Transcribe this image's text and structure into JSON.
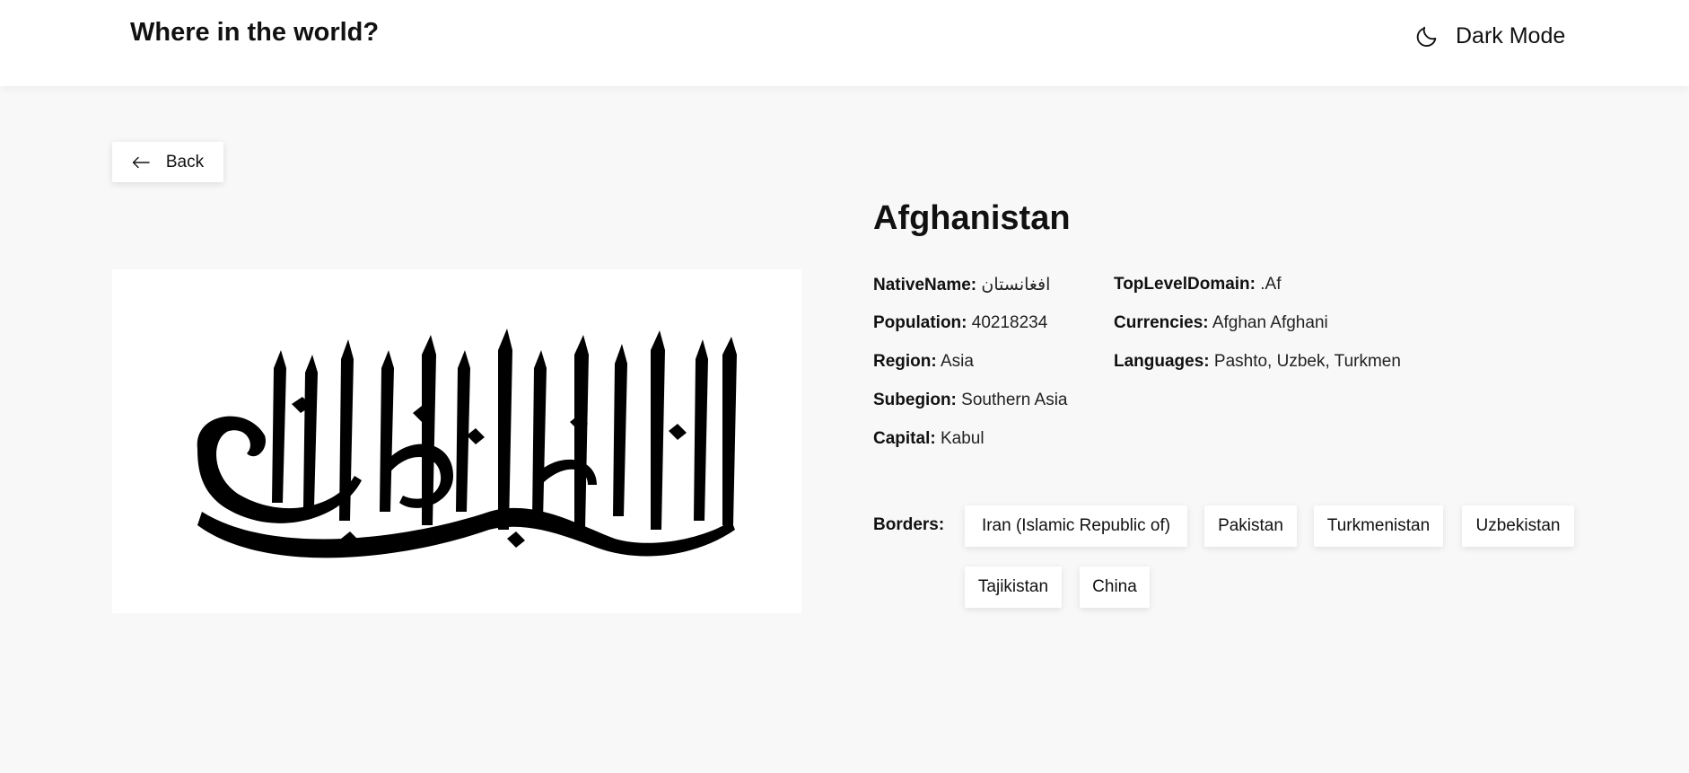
{
  "header": {
    "title": "Where in the world?",
    "mode_toggle_label": "Dark Mode",
    "mode_icon": "moon-icon"
  },
  "back_button": {
    "label": "Back",
    "icon": "arrow-left-icon"
  },
  "flag": {
    "description_text": "لا إله إلا الله محمد رسول الله",
    "background": "#ffffff",
    "ink": "#000000"
  },
  "country": {
    "name": "Afghanistan",
    "details": {
      "native_name": {
        "label": "NativeName:",
        "value": "افغانستان"
      },
      "population": {
        "label": "Population:",
        "value": "40218234"
      },
      "region": {
        "label": "Region:",
        "value": "Asia"
      },
      "subregion": {
        "label": "Subegion:",
        "value": "Southern Asia"
      },
      "capital": {
        "label": "Capital:",
        "value": "Kabul"
      },
      "top_level_domain": {
        "label": "TopLevelDomain:",
        "value": ".Af"
      },
      "currencies": {
        "label": "Currencies:",
        "value": "Afghan Afghani"
      },
      "languages": {
        "label": "Languages:",
        "value": "Pashto, Uzbek, Turkmen"
      }
    },
    "borders_label": "Borders:",
    "borders": [
      "Iran (Islamic Republic of)",
      "Pakistan",
      "Turkmenistan",
      "Uzbekistan",
      "Tajikistan",
      "China"
    ]
  },
  "colors": {
    "page_background": "#f8f8f8",
    "element_background": "#ffffff",
    "text": "#111111"
  }
}
